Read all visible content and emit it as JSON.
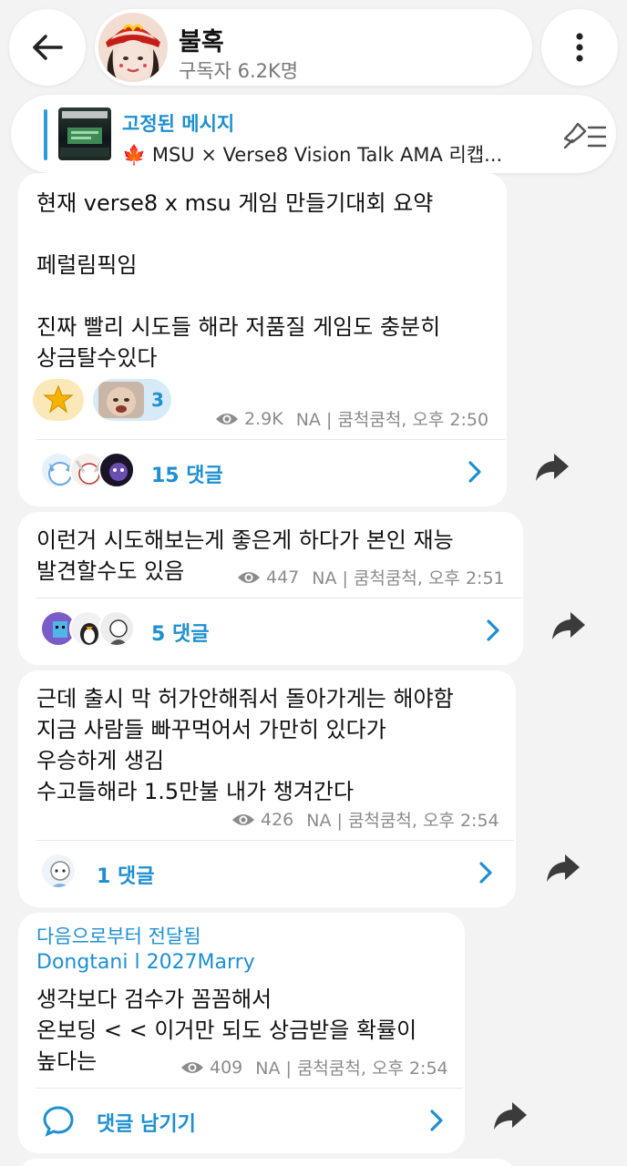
{
  "header": {
    "title": "불혹",
    "subtitle": "구독자 6.2K명"
  },
  "pinned": {
    "title": "고정된 메시지",
    "text": "MSU × Verse8 Vision Talk AMA 리캡..."
  },
  "messages": [
    {
      "text": "현재 verse8 x msu 게임 만들기대회 요약\n\n페럴림픽임\n\n진짜 빨리 시도들 해라 저품질 게임도 충분히\n상금탈수있다",
      "reaction_count": "3",
      "views": "2.9K",
      "meta": "NA | 쿰척쿰척, 오후 2:50",
      "comments": "15 댓글"
    },
    {
      "text": "이런거 시도해보는게 좋은게 하다가 본인 재능\n발견할수도 있음",
      "views": "447",
      "meta": "NA | 쿰척쿰척, 오후 2:51",
      "comments": "5 댓글"
    },
    {
      "text": "근데 출시 막 허가안해줘서 돌아가게는 해야함\n지금 사람들 빠꾸먹어서 가만히 있다가\n우승하게 생김\n수고들해라 1.5만불 내가 챙겨간다",
      "views": "426",
      "meta": "NA | 쿰척쿰척, 오후 2:54",
      "comments": "1 댓글"
    },
    {
      "forwarded_label": "다음으로부터 전달됨",
      "forwarded_from": "Dongtani l 2027Marry",
      "text": "생각보다 검수가 꼼꼼해서\n온보딩 < < 이거만 되도 상금받을 확률이\n높다는",
      "views": "409",
      "meta": "NA | 쿰척쿰척, 오후 2:54",
      "comments": "댓글 남기기"
    }
  ],
  "colors": {
    "accent": "#1e8fd0",
    "bubble": "#ffffff",
    "background": "#f3f3f3",
    "meta": "#8b8b8b"
  },
  "icons": [
    "back-arrow-icon",
    "more-vertical-icon",
    "unpin-icon",
    "eye-icon",
    "chevron-right-icon",
    "share-icon",
    "comment-icon",
    "star-emoji-icon"
  ]
}
